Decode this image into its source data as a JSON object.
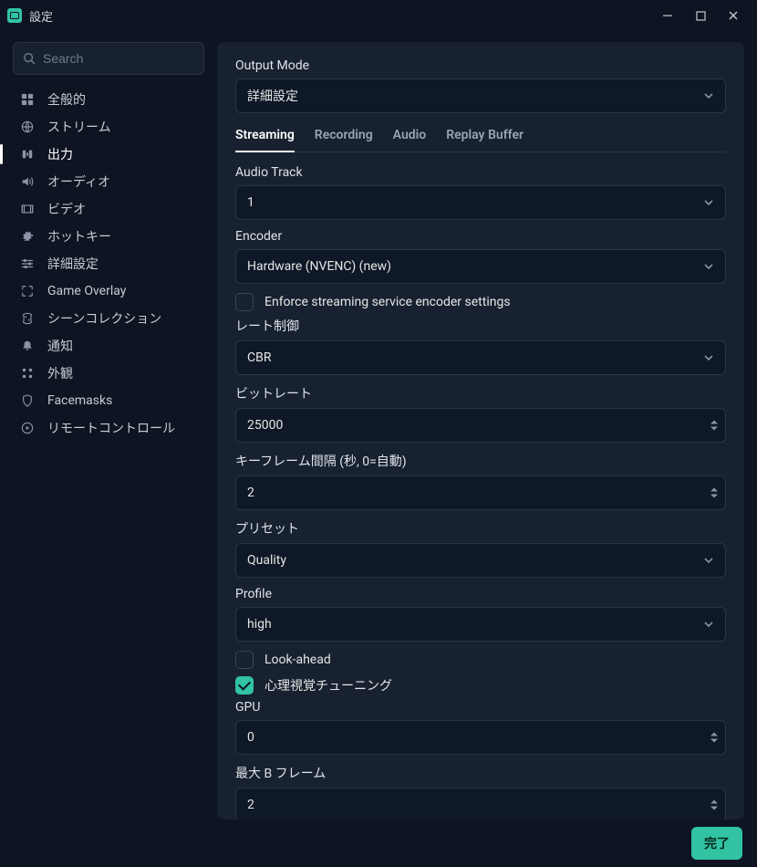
{
  "window": {
    "title": "設定"
  },
  "search": {
    "placeholder": "Search"
  },
  "sidebar": {
    "items": [
      {
        "label": "全般的",
        "icon": "grid"
      },
      {
        "label": "ストリーム",
        "icon": "globe"
      },
      {
        "label": "出力",
        "icon": "output",
        "active": true
      },
      {
        "label": "オーディオ",
        "icon": "audio"
      },
      {
        "label": "ビデオ",
        "icon": "video"
      },
      {
        "label": "ホットキー",
        "icon": "gear"
      },
      {
        "label": "詳細設定",
        "icon": "sliders"
      },
      {
        "label": "Game Overlay",
        "icon": "overlay"
      },
      {
        "label": "シーンコレクション",
        "icon": "collection"
      },
      {
        "label": "通知",
        "icon": "bell"
      },
      {
        "label": "外観",
        "icon": "appearance"
      },
      {
        "label": "Facemasks",
        "icon": "shield"
      },
      {
        "label": "リモートコントロール",
        "icon": "play"
      }
    ]
  },
  "main": {
    "output_mode_label": "Output Mode",
    "output_mode_value": "詳細設定",
    "tabs": [
      {
        "label": "Streaming",
        "active": true
      },
      {
        "label": "Recording"
      },
      {
        "label": "Audio"
      },
      {
        "label": "Replay Buffer"
      }
    ],
    "audio_track_label": "Audio Track",
    "audio_track_value": "1",
    "encoder_label": "Encoder",
    "encoder_value": "Hardware (NVENC) (new)",
    "enforce_label": "Enforce streaming service encoder settings",
    "enforce_checked": false,
    "rate_control_label": "レート制御",
    "rate_control_value": "CBR",
    "bitrate_label": "ビットレート",
    "bitrate_value": "25000",
    "keyframe_label": "キーフレーム間隔 (秒, 0=自動)",
    "keyframe_value": "2",
    "preset_label": "プリセット",
    "preset_value": "Quality",
    "profile_label": "Profile",
    "profile_value": "high",
    "lookahead_label": "Look-ahead",
    "lookahead_checked": false,
    "psycho_label": "心理視覚チューニング",
    "psycho_checked": true,
    "gpu_label": "GPU",
    "gpu_value": "0",
    "bframes_label": "最大 B フレーム",
    "bframes_value": "2"
  },
  "footer": {
    "done_label": "完了"
  },
  "colors": {
    "accent": "#31c3a2",
    "bg": "#0e1421",
    "panel": "#17212f"
  }
}
